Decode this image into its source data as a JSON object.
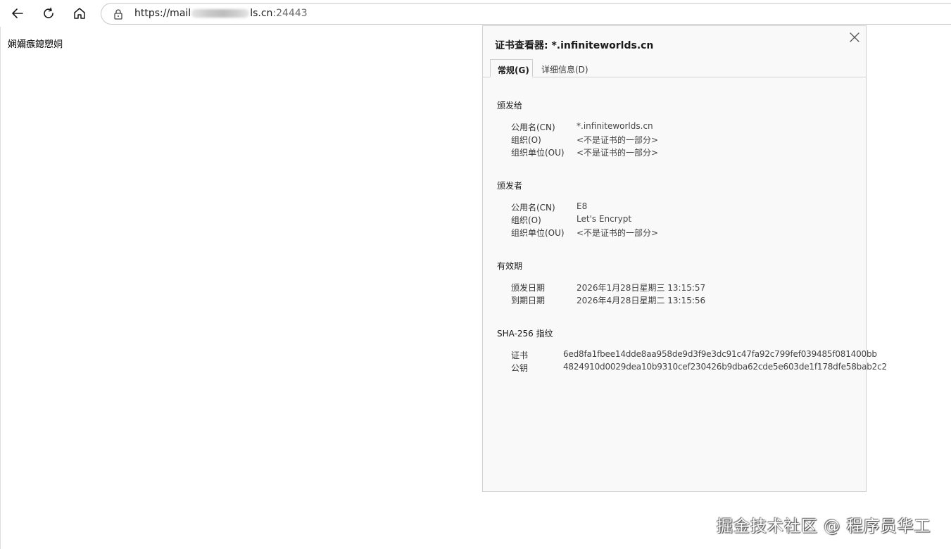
{
  "browser": {
    "url_visible_start": "https://mail",
    "url_visible_end": "ls.cn",
    "url_port": ":24443"
  },
  "page": {
    "garbled_text": "娴嬭瘯鎴愬姛"
  },
  "dialog": {
    "title": "证书查看器: *.infiniteworlds.cn",
    "tabs": [
      "常规(G)",
      "详细信息(D)"
    ],
    "issued_to": {
      "heading": "颁发给",
      "rows": [
        {
          "label": "公用名(CN)",
          "value": "*.infiniteworlds.cn"
        },
        {
          "label": "组织(O)",
          "value": "<不是证书的一部分>"
        },
        {
          "label": "组织单位(OU)",
          "value": "<不是证书的一部分>"
        }
      ]
    },
    "issued_by": {
      "heading": "颁发者",
      "rows": [
        {
          "label": "公用名(CN)",
          "value": "E8"
        },
        {
          "label": "组织(O)",
          "value": "Let's Encrypt"
        },
        {
          "label": "组织单位(OU)",
          "value": "<不是证书的一部分>"
        }
      ]
    },
    "validity": {
      "heading": "有效期",
      "rows": [
        {
          "label": "颁发日期",
          "value": "2026年1月28日星期三 13:15:57"
        },
        {
          "label": "到期日期",
          "value": "2026年4月28日星期二 13:15:56"
        }
      ]
    },
    "fingerprints": {
      "heading": "SHA-256 指纹",
      "rows": [
        {
          "label": "证书",
          "value": "6ed8fa1fbee14dde8aa958de9d3f9e3dc91c47fa92c799fef039485f081400bb"
        },
        {
          "label": "公钥",
          "value": "4824910d0029dea10b9310cef230426b9dba62cde5e603de1f178dfe58bab2c2"
        }
      ]
    }
  },
  "watermark": "掘金技术社区 @ 程序员华工"
}
